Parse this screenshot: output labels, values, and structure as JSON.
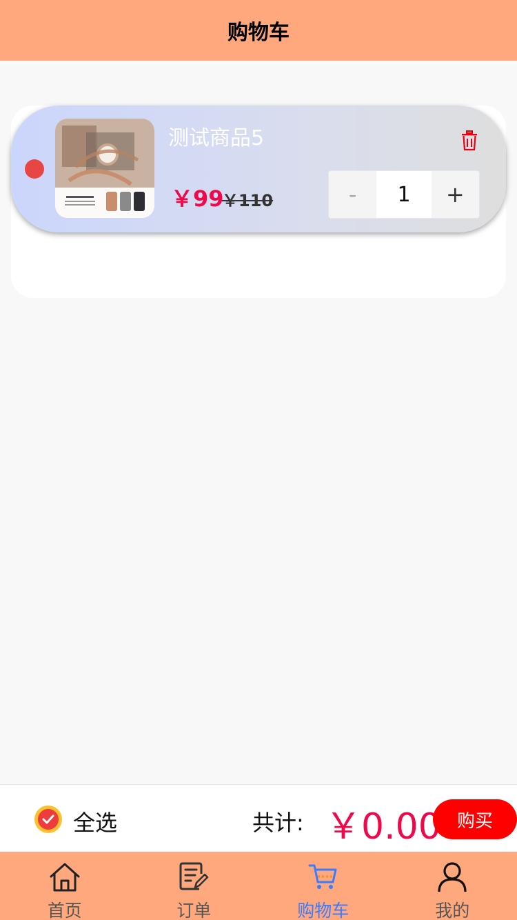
{
  "header": {
    "title": "购物车"
  },
  "cart": {
    "items": [
      {
        "name": "测试商品5",
        "price": "￥99",
        "original_price": "￥110",
        "quantity": "1",
        "minus_label": "-",
        "plus_label": "+",
        "thumb_icon": "watch-product-image",
        "delete_icon": "trash-icon",
        "selected_color": "#e84545"
      }
    ]
  },
  "checkout": {
    "select_all_label": "全选",
    "total_label": "共计:",
    "total_value": "￥0.00",
    "buy_label": "购买"
  },
  "tabbar": {
    "tabs": [
      {
        "label": "首页",
        "icon": "home-icon"
      },
      {
        "label": "订单",
        "icon": "order-icon"
      },
      {
        "label": "购物车",
        "icon": "cart-icon",
        "active": true
      },
      {
        "label": "我的",
        "icon": "user-icon"
      }
    ]
  },
  "colors": {
    "header_bg": "#ffa87d",
    "price": "#ee0a4a",
    "buy_button": "#ff0000",
    "active_tab": "#3a7bff"
  }
}
